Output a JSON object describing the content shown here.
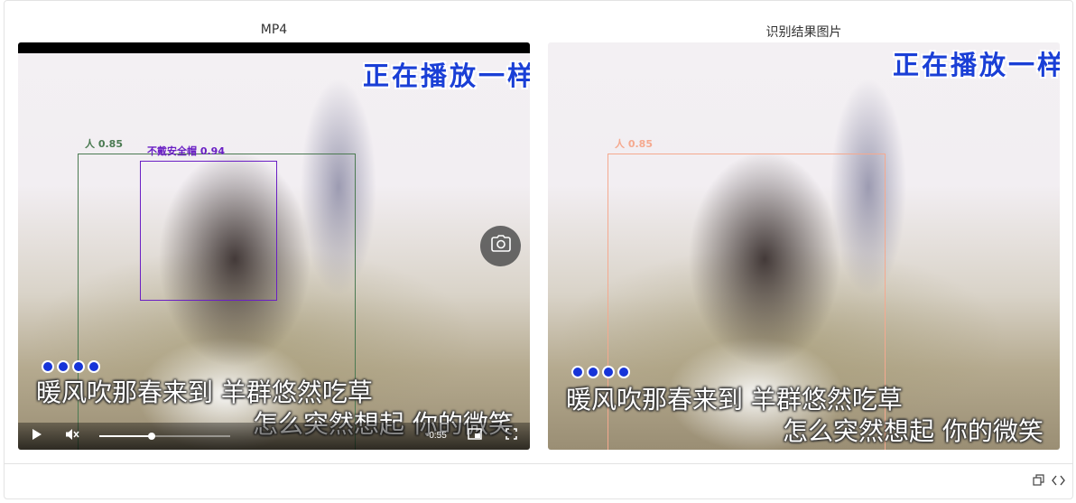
{
  "left_panel": {
    "title": "MP4",
    "watermark": "正在播放一样",
    "lyrics": [
      "暖风吹那春来到 羊群悠然吃草",
      "怎么突然想起 你的微笑"
    ],
    "detections": [
      {
        "label": "人 0.85",
        "color": "#4b7a52"
      },
      {
        "label": "不戴安全帽 0.94",
        "color": "#6a1fc4"
      }
    ],
    "player": {
      "play_icon": "play-icon",
      "mute_icon": "volume-muted-icon",
      "progress": 0.4,
      "time_remaining": "-0:55",
      "pip_icon": "picture-in-picture-icon",
      "fullscreen_icon": "fullscreen-icon"
    },
    "snapshot_icon": "camera-icon"
  },
  "right_panel": {
    "title": "识别结果图片",
    "watermark": "正在播放一样",
    "lyrics": [
      "暖风吹那春来到 羊群悠然吃草",
      "怎么突然想起 你的微笑"
    ],
    "detections": [
      {
        "label": "人 0.85",
        "color": "#f5a98f"
      }
    ]
  },
  "footer": {
    "copy_icon": "copy-icon",
    "code_icon": "code-icon"
  }
}
